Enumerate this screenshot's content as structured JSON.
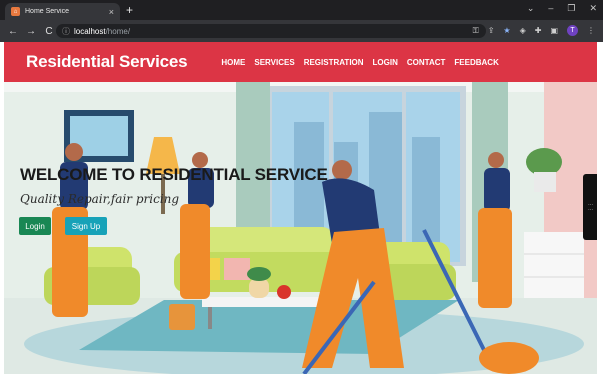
{
  "browser": {
    "tab_title": "Home Service",
    "tab_close": "×",
    "new_tab": "+",
    "back": "←",
    "forward": "→",
    "reload": "C",
    "url_host": "localhost",
    "url_path": "/home/",
    "window_controls": [
      "⌄",
      "–",
      "❐",
      "✕"
    ],
    "profile_initial": "T"
  },
  "site": {
    "brand": "Residential Services",
    "nav": [
      "HOME",
      "SERVICES",
      "REGISTRATION",
      "LOGIN",
      "CONTACT",
      "FEEDBACK"
    ]
  },
  "hero": {
    "title": "WELCOME TO RESIDENTIAL SERVICE",
    "subtitle": "Quality Repair,fair pricing",
    "login_label": "Login",
    "signup_label": "Sign Up"
  },
  "colors": {
    "nav_bg": "#dc3545",
    "login_btn": "#198754",
    "signup_btn": "#17a2b8"
  }
}
